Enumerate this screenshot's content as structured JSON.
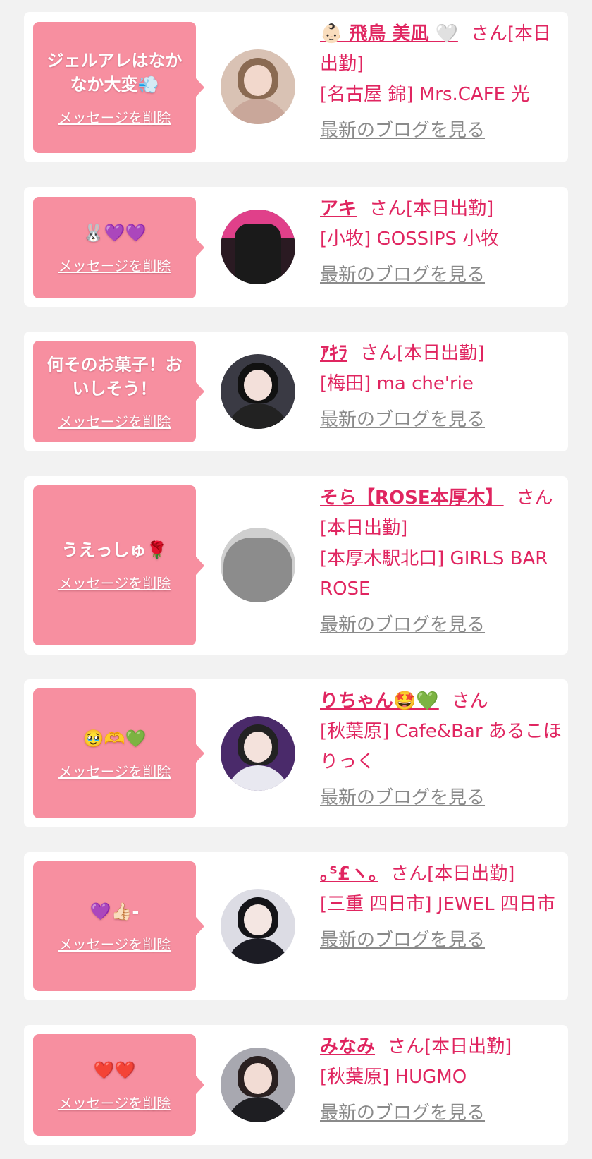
{
  "delete_label": "メッセージを削除",
  "blog_label": "最新のブログを見る",
  "colors": {
    "bubble": "#f78fa0",
    "accent": "#e02560",
    "link_gray": "#8a8a8a",
    "background": "#f2f2f2"
  },
  "items": [
    {
      "message": "ジェルアレはなかなか大変💨",
      "name": "👶🏻 飛鳥 美凪 🤍",
      "suffix": "さん[本日出勤]",
      "shop": "[名古屋 錦] Mrs.CAFE 光"
    },
    {
      "message": "🐰💜💜",
      "name": "アキ",
      "suffix": "さん[本日出勤]",
      "shop": "[小牧] GOSSIPS 小牧"
    },
    {
      "message": "何そのお菓子！おいしそう！",
      "name": "ｱｷﾗ",
      "suffix": "さん[本日出勤]",
      "shop": "[梅田] ma che'rie"
    },
    {
      "message": "うえっしゅ🌹",
      "name": "そら【ROSE本厚木】",
      "suffix": "さん[本日出勤]",
      "shop": "[本厚木駅北口] GIRLS BAR ROSE"
    },
    {
      "message": "🥹🫶💚",
      "name": "りちゃん🤩💚",
      "suffix": "さん",
      "shop": "[秋葉原] Cafe&Bar あるこほりっく"
    },
    {
      "message": "💜👍🏻-",
      "name": "｡ᔆ£ヽ｡",
      "suffix": "さん[本日出勤]",
      "shop": "[三重 四日市] JEWEL 四日市"
    },
    {
      "message": "❤️❤️",
      "name": "みなみ",
      "suffix": "さん[本日出勤]",
      "shop": "[秋葉原] HUGMO"
    }
  ]
}
